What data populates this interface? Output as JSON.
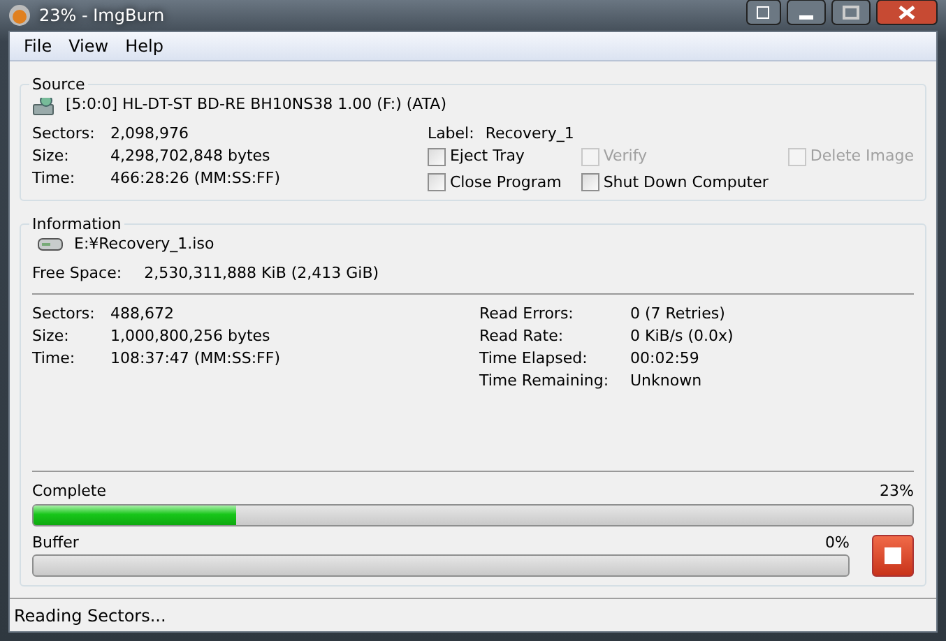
{
  "window": {
    "title": "23% - ImgBurn"
  },
  "menu": [
    {
      "label": "File"
    },
    {
      "label": "View"
    },
    {
      "label": "Help"
    }
  ],
  "source": {
    "title": "Source",
    "device": "[5:0:0] HL-DT-ST BD-RE  BH10NS38 1.00 (F:) (ATA)",
    "fields": [
      {
        "label": "Sectors:",
        "value": "2,098,976"
      },
      {
        "label": "Size:",
        "value": "4,298,702,848 bytes"
      },
      {
        "label": "Time:",
        "value": "466:28:26 (MM:SS:FF)"
      }
    ],
    "disc_label": {
      "label": "Label:",
      "value": "Recovery_1"
    },
    "options": [
      {
        "label": "Eject Tray",
        "checked": false,
        "disabled": false
      },
      {
        "label": "Verify",
        "checked": false,
        "disabled": true
      },
      {
        "label": "Delete Image",
        "checked": false,
        "disabled": true
      },
      {
        "label": "Close Program",
        "checked": false,
        "disabled": false
      },
      {
        "label": "Shut Down Computer",
        "checked": false,
        "disabled": false
      }
    ]
  },
  "information": {
    "title": "Information",
    "file": "E:¥Recovery_1.iso",
    "free_space": {
      "label": "Free Space:",
      "value": "2,530,311,888 KiB  (2,413 GiB)"
    },
    "left": [
      {
        "label": "Sectors:",
        "value": "488,672"
      },
      {
        "label": "Size:",
        "value": "1,000,800,256 bytes"
      },
      {
        "label": "Time:",
        "value": "108:37:47 (MM:SS:FF)"
      }
    ],
    "right": [
      {
        "label": "Read Errors:",
        "value": "0 (7 Retries)"
      },
      {
        "label": "Read Rate:",
        "value": "0 KiB/s (0.0x)"
      },
      {
        "label": "Time Elapsed:",
        "value": "00:02:59"
      },
      {
        "label": "Time Remaining:",
        "value": "Unknown"
      }
    ],
    "complete": {
      "label": "Complete",
      "reading": "23%",
      "level": 0.23
    },
    "buffer": {
      "label": "Buffer",
      "reading": "0%",
      "level": 0
    }
  },
  "status_bar": "Reading Sectors..."
}
